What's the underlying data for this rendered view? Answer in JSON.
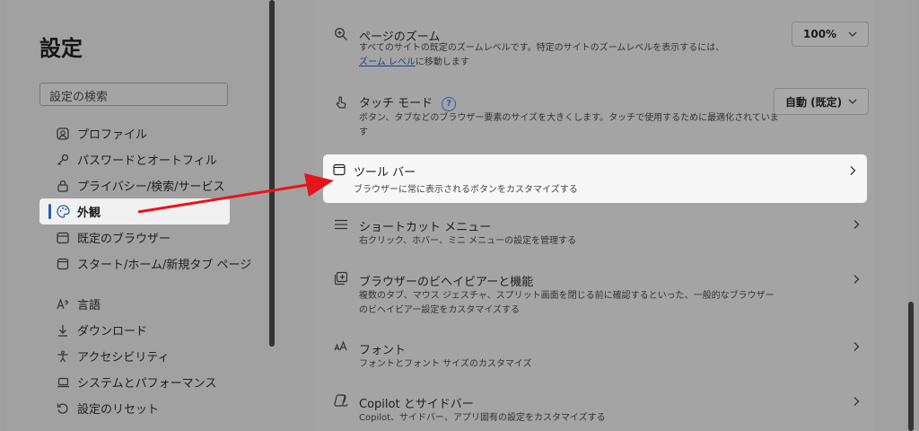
{
  "sidebar": {
    "title": "設定",
    "search_placeholder": "設定の検索",
    "items": [
      {
        "label": "プロファイル",
        "icon": "profile-icon"
      },
      {
        "label": "パスワードとオートフィル",
        "icon": "key-icon"
      },
      {
        "label": "プライバシー/検索/サービス",
        "icon": "lock-icon"
      },
      {
        "label": "外観",
        "icon": "palette-icon",
        "selected": true
      },
      {
        "label": "既定のブラウザー",
        "icon": "browser-icon"
      },
      {
        "label": "スタート/ホーム/新規タブ ページ",
        "icon": "home-icon"
      },
      {
        "label": "言語",
        "icon": "language-icon"
      },
      {
        "label": "ダウンロード",
        "icon": "download-icon"
      },
      {
        "label": "アクセシビリティ",
        "icon": "accessibility-icon"
      },
      {
        "label": "システムとパフォーマンス",
        "icon": "laptop-icon"
      },
      {
        "label": "設定のリセット",
        "icon": "reset-icon"
      }
    ]
  },
  "main": {
    "zoom": {
      "title": "ページのズーム",
      "desc_1": "すべてのサイトの既定のズームレベルです。特定のサイトのズームレベルを表示するには、",
      "link": "ズーム レベル",
      "desc_2": "に移動します",
      "value": "100%"
    },
    "touch": {
      "title": "タッチ モード",
      "help": "?",
      "desc": "ボタン、タブなどのブラウザー要素のサイズを大きくします。タッチで使用するために最適化されています",
      "value": "自動 (既定)"
    },
    "toolbar": {
      "title": "ツール バー",
      "desc": "ブラウザーに常に表示されるボタンをカスタマイズする"
    },
    "shortcut": {
      "title": "ショートカット メニュー",
      "desc": "右クリック、ホバー、ミニ メニューの設定を管理する"
    },
    "behavior": {
      "title": "ブラウザーのビヘイビアーと機能",
      "desc": "複数のタブ、マウス ジェスチャ、スプリット画面を閉じる前に確認するといった、一般的なブラウザーのビヘイビアー設定をカスタマイズする"
    },
    "font": {
      "title": "フォント",
      "desc": "フォントとフォント サイズのカスタマイズ"
    },
    "copilot": {
      "title": "Copilot とサイドバー",
      "desc": "Copilot、サイドバー、アプリ固有の設定をカスタマイズする"
    }
  },
  "colors": {
    "highlight": "#f7f7f7",
    "accent": "#2a5fa8",
    "arrow": "#e8141b"
  }
}
